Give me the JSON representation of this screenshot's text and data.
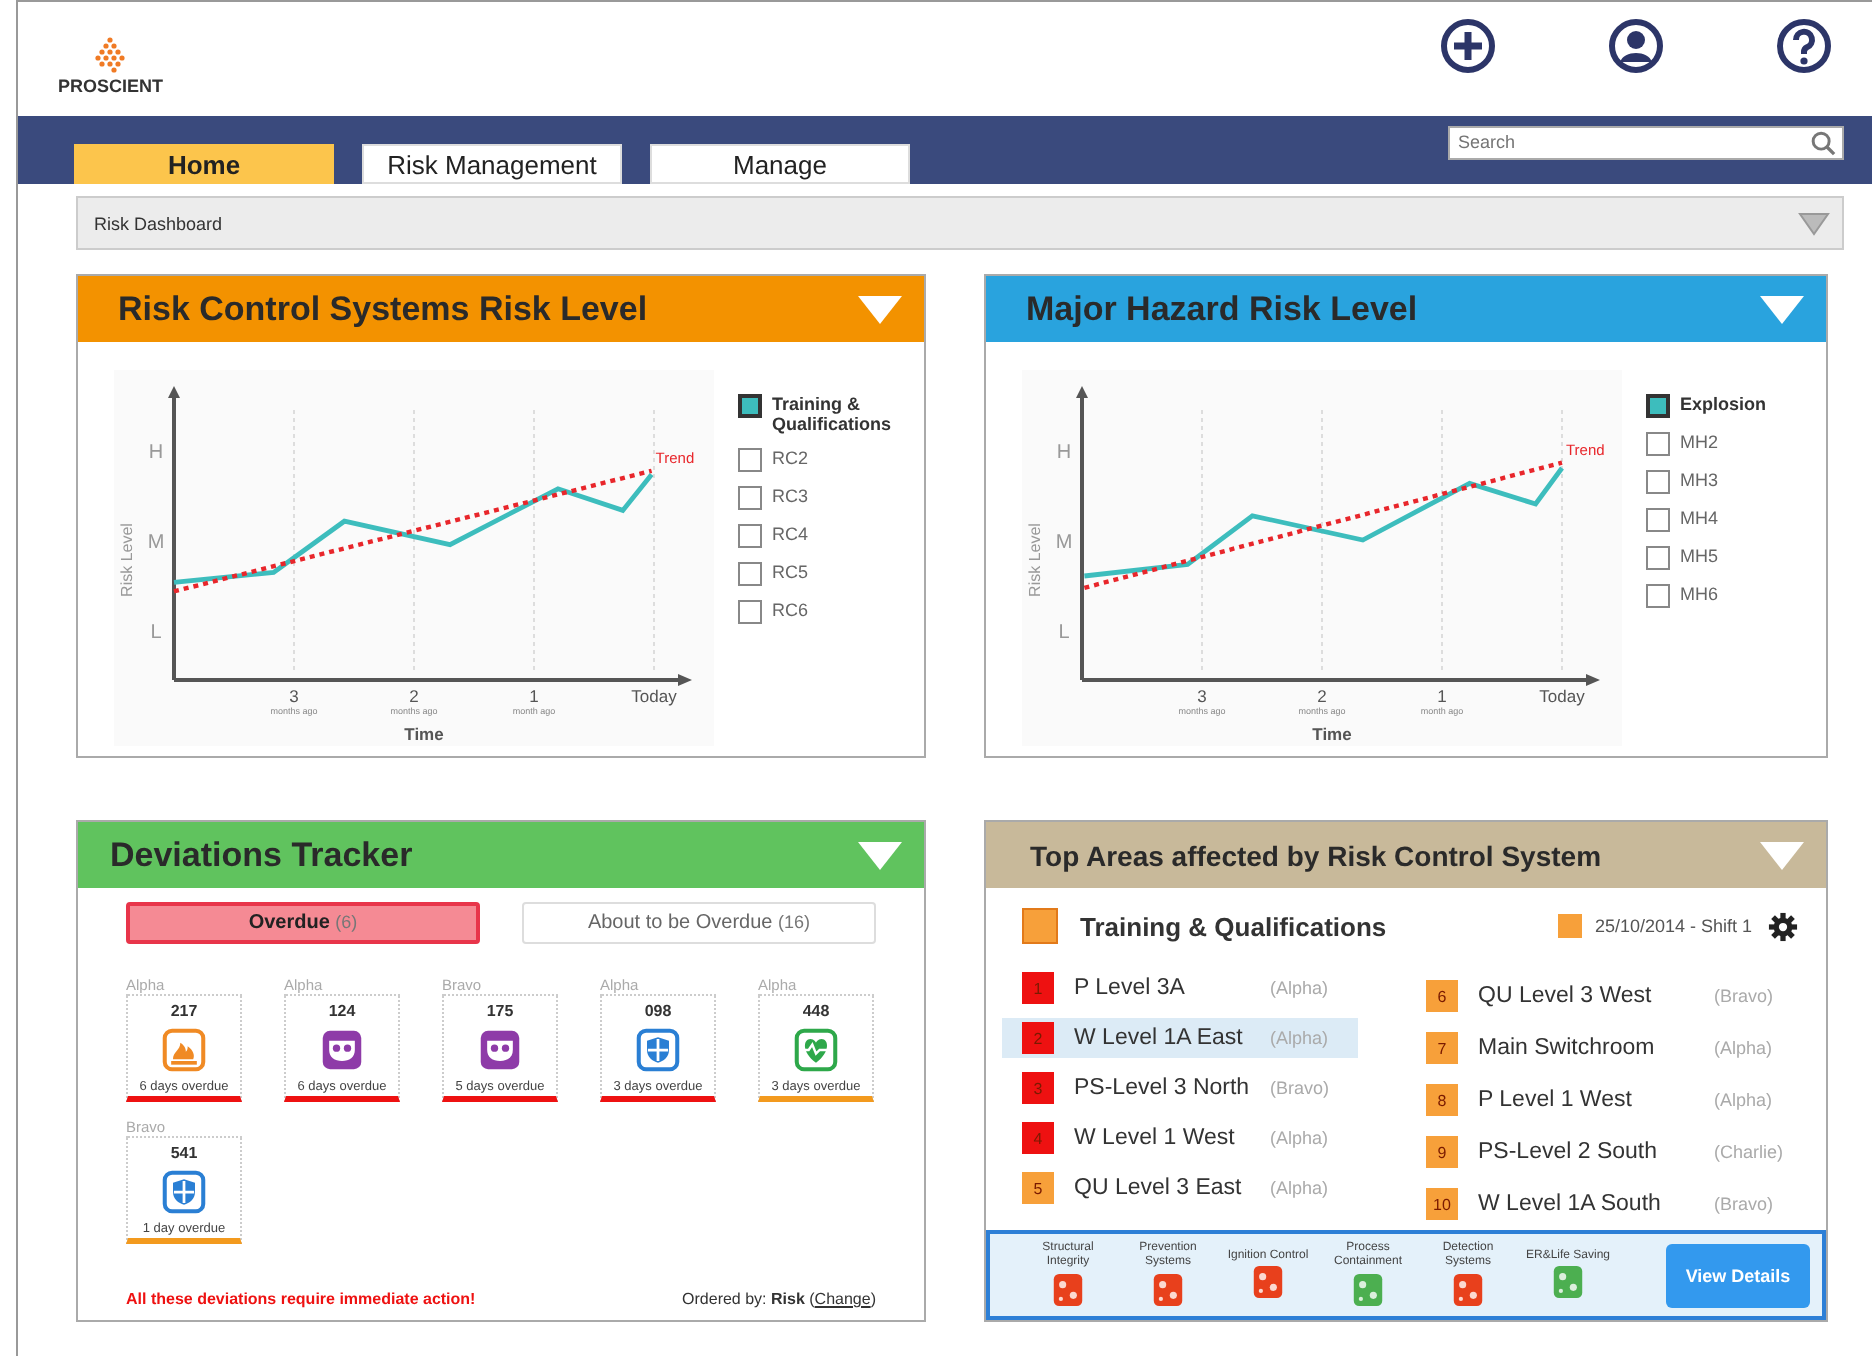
{
  "header": {
    "logo_text": "PROSCIENT"
  },
  "nav": {
    "tabs": [
      {
        "label": "Home",
        "selected": true
      },
      {
        "label": "Risk Management",
        "selected": false
      },
      {
        "label": "Manage",
        "selected": false
      }
    ],
    "search": {
      "placeholder": "Search"
    }
  },
  "breadcrumb": {
    "label": "Risk Dashboard"
  },
  "risk_panels": [
    {
      "title": "Risk Control Systems Risk Level",
      "color": "#f39200",
      "chart": {
        "ylabel": "Risk Level",
        "y_labels": [
          "H",
          "M",
          "L"
        ],
        "x_labels": [
          "3",
          "2",
          "1",
          "Today"
        ],
        "x_notes": [
          "months ago",
          "months ago",
          "month ago"
        ],
        "xlabel": "Time",
        "trend_label": "Trend"
      },
      "legend": [
        {
          "label": "Training & Qualifications",
          "checked": true
        },
        {
          "label": "RC2",
          "checked": false
        },
        {
          "label": "RC3",
          "checked": false
        },
        {
          "label": "RC4",
          "checked": false
        },
        {
          "label": "RC5",
          "checked": false
        },
        {
          "label": "RC6",
          "checked": false
        }
      ]
    },
    {
      "title": "Major Hazard Risk Level",
      "color": "#29a3de",
      "chart": {
        "ylabel": "Risk Level",
        "y_labels": [
          "H",
          "M",
          "L"
        ],
        "x_labels": [
          "3",
          "2",
          "1",
          "Today"
        ],
        "x_notes": [
          "months ago",
          "months ago",
          "month ago"
        ],
        "xlabel": "Time",
        "trend_label": "Trend"
      },
      "legend": [
        {
          "label": "Explosion",
          "checked": true
        },
        {
          "label": "MH2",
          "checked": false
        },
        {
          "label": "MH3",
          "checked": false
        },
        {
          "label": "MH4",
          "checked": false
        },
        {
          "label": "MH5",
          "checked": false
        },
        {
          "label": "MH6",
          "checked": false
        }
      ]
    }
  ],
  "deviations": {
    "title": "Deviations Tracker",
    "tabs": [
      {
        "label": "Overdue",
        "count": "(6)",
        "selected": true
      },
      {
        "label": "About to be Overdue",
        "count": "(16)",
        "selected": false
      }
    ],
    "cards": [
      {
        "region": "Alpha",
        "number": "217",
        "kind": "fire",
        "overdue": "6 days overdue",
        "color": "#ee1111"
      },
      {
        "region": "Alpha",
        "number": "124",
        "kind": "mask",
        "overdue": "6 days overdue",
        "color": "#ee1111"
      },
      {
        "region": "Bravo",
        "number": "175",
        "kind": "mask",
        "overdue": "5 days overdue",
        "color": "#ee1111"
      },
      {
        "region": "Alpha",
        "number": "098",
        "kind": "shield",
        "overdue": "3 days overdue",
        "color": "#ee1111"
      },
      {
        "region": "Alpha",
        "number": "448",
        "kind": "heart",
        "overdue": "3 days overdue",
        "color": "#f39a1e"
      },
      {
        "region": "Bravo",
        "number": "541",
        "kind": "shield",
        "overdue": "1 day overdue",
        "color": "#f39a1e"
      }
    ],
    "warning": "All these deviations require immediate action!",
    "order_label": "Ordered by:",
    "order_value": "Risk",
    "open_paren": "(",
    "change_link": "Change",
    "close_paren": ")"
  },
  "top_areas": {
    "title": "Top Areas affected by Risk Control System",
    "system": "Training & Qualifications",
    "date": "25/10/2014 - Shift 1",
    "areas": [
      {
        "rank": "1",
        "name": "P Level 3A",
        "region": "(Alpha)",
        "color": "#ee1111",
        "selected": false
      },
      {
        "rank": "2",
        "name": "W Level 1A East",
        "region": "(Alpha)",
        "color": "#ee1111",
        "selected": true
      },
      {
        "rank": "3",
        "name": "PS-Level 3 North",
        "region": "(Bravo)",
        "color": "#ee1111",
        "selected": false
      },
      {
        "rank": "4",
        "name": "W Level 1 West",
        "region": "(Alpha)",
        "color": "#ee1111",
        "selected": false
      },
      {
        "rank": "5",
        "name": "QU Level 3 East",
        "region": "(Alpha)",
        "color": "#f7a03a",
        "selected": false
      },
      {
        "rank": "6",
        "name": "QU Level 3 West",
        "region": "(Bravo)",
        "color": "#f7a03a",
        "selected": false
      },
      {
        "rank": "7",
        "name": "Main Switchroom",
        "region": "(Alpha)",
        "color": "#f7a03a",
        "selected": false
      },
      {
        "rank": "8",
        "name": "P Level 1 West",
        "region": "(Alpha)",
        "color": "#f7a03a",
        "selected": false
      },
      {
        "rank": "9",
        "name": "PS-Level 2 South",
        "region": "(Charlie)",
        "color": "#f7a03a",
        "selected": false
      },
      {
        "rank": "10",
        "name": "W Level 1A South",
        "region": "(Bravo)",
        "color": "#f7a03a",
        "selected": false
      }
    ],
    "systems": [
      {
        "label": "Structural Integrity",
        "color": "#e8401c"
      },
      {
        "label": "Prevention Systems",
        "color": "#e8401c"
      },
      {
        "label": "Ignition Control",
        "color": "#e8401c"
      },
      {
        "label": "Process Containment",
        "color": "#4caf50"
      },
      {
        "label": "Detection Systems",
        "color": "#e8401c"
      },
      {
        "label": "ER&Life Saving",
        "color": "#4caf50"
      }
    ],
    "button": "View Details"
  }
}
